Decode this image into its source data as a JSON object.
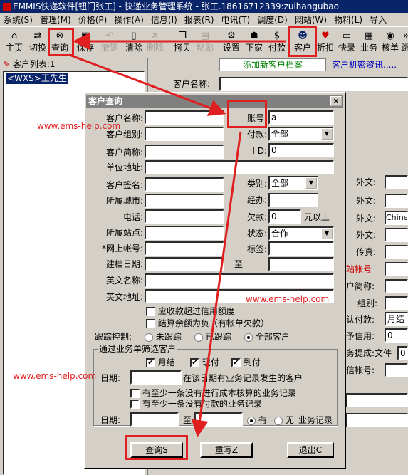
{
  "window": {
    "title": "EMMIS快递软件[钮门张工] - 快递业务管理系统 - 张工.18616712339:zuihangubao"
  },
  "menu": [
    "系统(S)",
    "管理(M)",
    "价格(P)",
    "操作(A)",
    "信息(I)",
    "报表(R)",
    "电讯(T)",
    "调度(D)",
    "网站(W)",
    "物料(L)",
    "导入"
  ],
  "toolbar": [
    {
      "label": "主页",
      "icon": "home-icon"
    },
    {
      "label": "切换",
      "icon": "switch-icon"
    },
    {
      "label": "查询",
      "icon": "binoculars-icon"
    },
    {
      "label": "保存",
      "icon": "save-icon"
    },
    {
      "label": "撤销",
      "icon": "undo-icon"
    },
    {
      "label": "清除",
      "icon": "clear-icon"
    },
    {
      "label": "删除",
      "icon": "delete-icon"
    },
    {
      "label": "拷贝",
      "icon": "copy-icon"
    },
    {
      "label": "粘贴",
      "icon": "paste-icon"
    },
    {
      "label": "设置",
      "icon": "settings-icon"
    },
    {
      "label": "下家",
      "icon": "next-party-icon"
    },
    {
      "label": "付款",
      "icon": "payment-icon"
    },
    {
      "label": "客户",
      "icon": "customers-icon"
    },
    {
      "label": "折扣",
      "icon": "discount-icon"
    },
    {
      "label": "快录",
      "icon": "quick-entry-icon"
    },
    {
      "label": "业务",
      "icon": "business-icon"
    },
    {
      "label": "核单",
      "icon": "check-order-icon"
    },
    {
      "label": "跳",
      "icon": "jump-icon"
    }
  ],
  "left": {
    "list_header": "客户列表:1",
    "items": [
      "<WXS>王先生"
    ]
  },
  "right": {
    "add_customer_link": "添加新客户档案",
    "secret_info_link": "客户机密资讯.....",
    "customer_name_label": "客户名称:",
    "side_labels": [
      "外文:",
      "外文:",
      "外文:",
      "外文:",
      "传真:",
      "网站帐号",
      "客户简称:",
      "组别:",
      "默认付款:",
      "给予信用:",
      "业务提成:文件",
      "微信帐号:"
    ],
    "side_values": {
      "foreign3": "Chinese",
      "default_payment": "月结",
      "credit": "0",
      "commission": "0"
    }
  },
  "dialog": {
    "title": "客户查询",
    "close": "×",
    "fields": {
      "customer_name": {
        "label": "客户名称:",
        "value": ""
      },
      "customer_group": {
        "label": "客户组别:",
        "value": ""
      },
      "customer_short": {
        "label": "客户简称:",
        "value": ""
      },
      "unit_address": {
        "label": "单位地址:",
        "value": ""
      },
      "customer_sign": {
        "label": "客户签名:",
        "value": ""
      },
      "city": {
        "label": "所属城市:",
        "value": ""
      },
      "phone": {
        "label": "电话:",
        "value": ""
      },
      "station": {
        "label": "所属站点:",
        "value": ""
      },
      "web_account": {
        "label": "*网上帐号:",
        "value": ""
      },
      "created_date": {
        "label": "建档日期:",
        "value": ""
      },
      "english_name": {
        "label": "英文名称:",
        "value": ""
      },
      "english_address": {
        "label": "英文地址:",
        "value": ""
      },
      "account": {
        "label": "账号:",
        "value": "a"
      },
      "payment": {
        "label": "付款:",
        "value": "全部"
      },
      "id": {
        "label": "I D:",
        "value": "0"
      },
      "category": {
        "label": "类别:",
        "value": "全部"
      },
      "handler": {
        "label": "经办:",
        "value": ""
      },
      "arrears": {
        "label": "欠款:",
        "value": "0",
        "suffix": "元以上"
      },
      "status": {
        "label": "状态:",
        "value": "合作"
      },
      "tag": {
        "label": "标签:",
        "value": ""
      },
      "to": {
        "label": "至",
        "value": ""
      }
    },
    "checks": {
      "over_credit": "应收款超过信用额度",
      "negative_balance": "结算余额为负（有帐单欠款）"
    },
    "tracking": {
      "label": "跟踪控制:",
      "options": [
        "未跟踪",
        "已跟踪",
        "全部客户"
      ],
      "selected": 2
    },
    "filter_group": {
      "title": "通过业务单筛选客户",
      "pay_types": [
        "月结",
        "现付",
        "到付"
      ],
      "date_label": "日期:",
      "date_suffix": "在该日期有业务记录发生的客户",
      "cost_check": "有至少一条没有进行成本核算的业务记录",
      "unpaid_check": "有至少一条没有付款的业务记录"
    },
    "bottom_date": {
      "label": "日期:",
      "to": "至",
      "options": [
        "有",
        "无"
      ],
      "selected": 0,
      "suffix": "业务记录"
    },
    "buttons": {
      "query": "查询S",
      "rewrite": "重写Z",
      "exit": "退出C"
    }
  },
  "watermarks": [
    "www.ems-help.com",
    "www.ems-help.com",
    "www.ems-help.com"
  ],
  "colors": {
    "annotation": "#e02020",
    "titlebar": "#0a246a",
    "link": "#0000c0",
    "add_link": "#008000"
  }
}
